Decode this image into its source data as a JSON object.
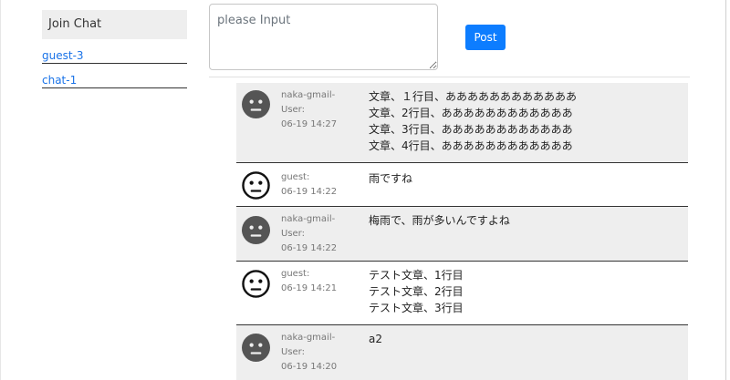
{
  "sidebar": {
    "join_chat_label": "Join Chat",
    "rooms": [
      {
        "label": "guest-3"
      },
      {
        "label": "chat-1"
      }
    ]
  },
  "composer": {
    "placeholder": "please Input",
    "value": "",
    "post_label": "Post"
  },
  "messages": [
    {
      "user_line1": "naka-gmail-",
      "user_line2": "User:",
      "time": "06-19 14:27",
      "lines": [
        "文章、１行目、ああああああああああああ",
        "文章、2行目、ああああああああああああ",
        "文章、3行目、ああああああああああああ",
        "文章、4行目、ああああああああああああ"
      ]
    },
    {
      "user_line1": "guest:",
      "user_line2": "",
      "time": "06-19 14:22",
      "lines": [
        "雨ですね"
      ]
    },
    {
      "user_line1": "naka-gmail-",
      "user_line2": "User:",
      "time": "06-19 14:22",
      "lines": [
        "梅雨で、雨が多いんですよね"
      ]
    },
    {
      "user_line1": "guest:",
      "user_line2": "",
      "time": "06-19 14:21",
      "lines": [
        "テスト文章、1行目",
        "テスト文章、2行目",
        "テスト文章、3行目"
      ]
    },
    {
      "user_line1": "naka-gmail-",
      "user_line2": "User:",
      "time": "06-19 14:20",
      "lines": [
        "a2"
      ]
    }
  ]
}
